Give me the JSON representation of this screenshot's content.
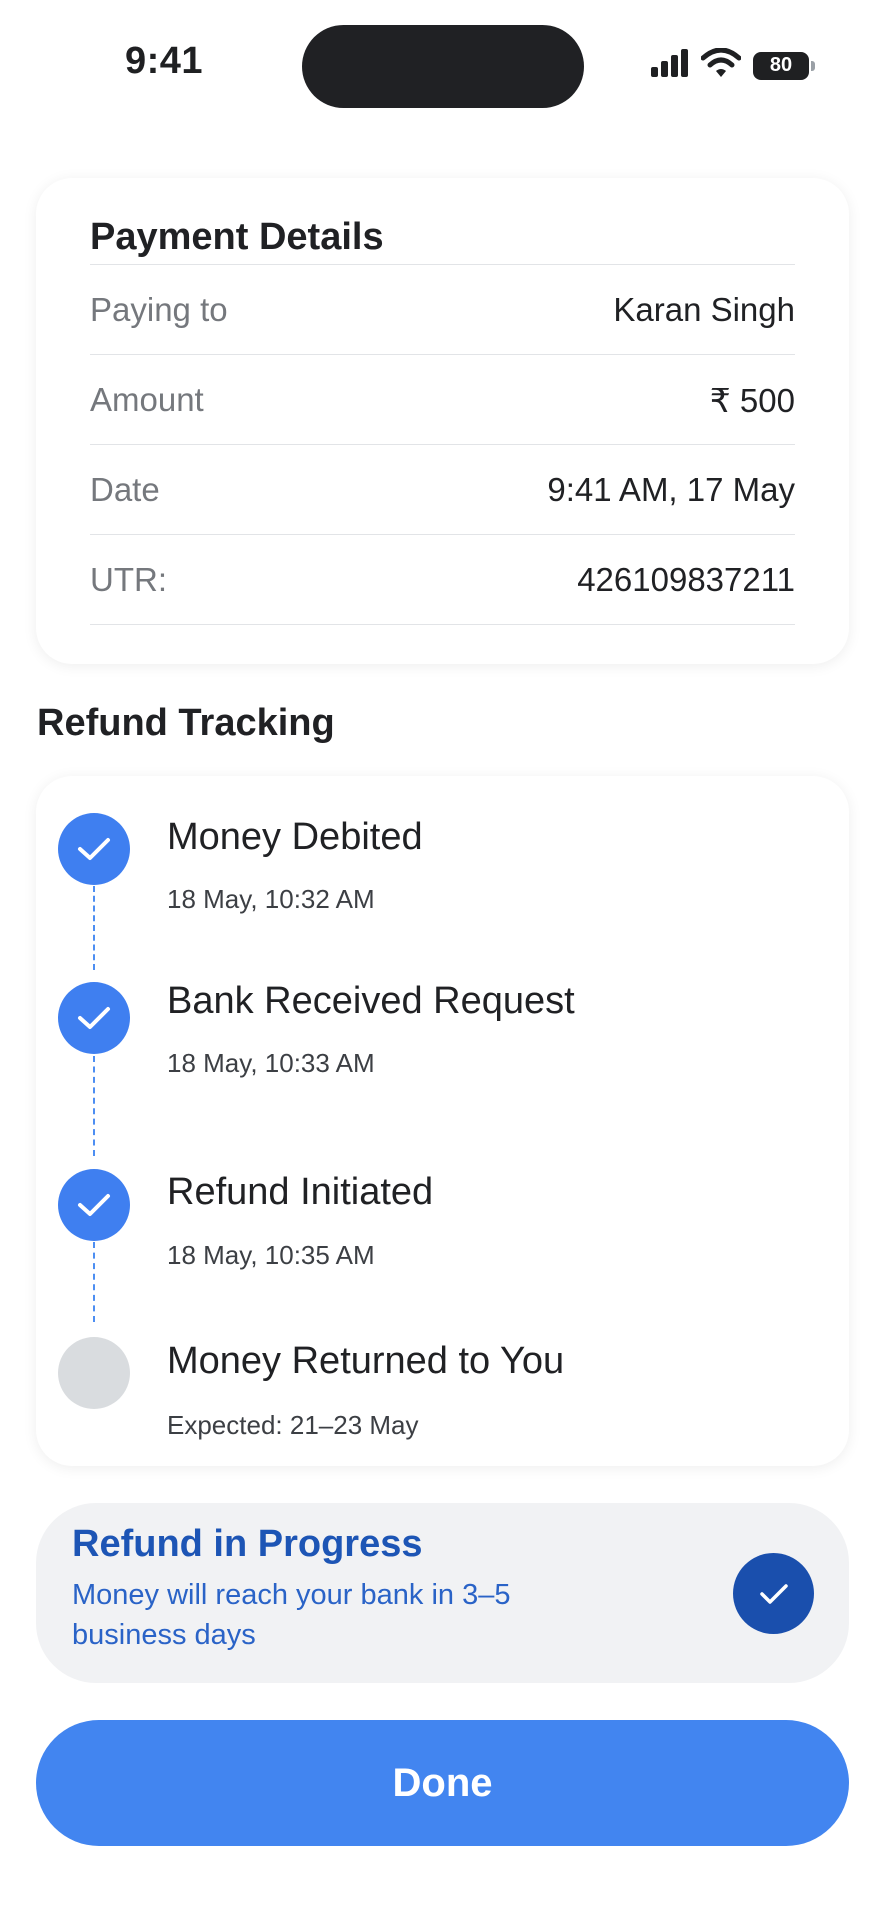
{
  "status_bar": {
    "time": "9:41",
    "battery_level": "80",
    "icons": [
      "cellular-signal-icon",
      "wifi-icon",
      "battery-icon"
    ]
  },
  "payment_details": {
    "title": "Payment Details",
    "rows": [
      {
        "label": "Paying to",
        "value": "Karan Singh"
      },
      {
        "label": "Amount",
        "value": "₹ 500"
      },
      {
        "label": "Date",
        "value": "9:41 AM, 17 May"
      },
      {
        "label": "UTR:",
        "value": "426109837211"
      }
    ]
  },
  "refund_tracking": {
    "title": "Refund Tracking",
    "steps": [
      {
        "title": "Money Debited",
        "time": "18 May, 10:32 AM",
        "status": "done"
      },
      {
        "title": "Bank Received Request",
        "time": "18 May, 10:33 AM",
        "status": "done"
      },
      {
        "title": "Refund Initiated",
        "time": "18 May, 10:35 AM",
        "status": "done"
      },
      {
        "title": "Money Returned to You",
        "time": "Expected: 21–23 May",
        "status": "pending"
      }
    ]
  },
  "status_banner": {
    "title": "Refund in Progress",
    "message": "Money will reach your bank in 3–5 business days",
    "icon": "check-icon"
  },
  "done_label": "Done",
  "colors": {
    "accent": "#4285f0",
    "step_done": "#3f7ff0",
    "step_pending": "#d9dcdf",
    "banner_text": "#1d55b5",
    "banner_check": "#1a4fad"
  }
}
